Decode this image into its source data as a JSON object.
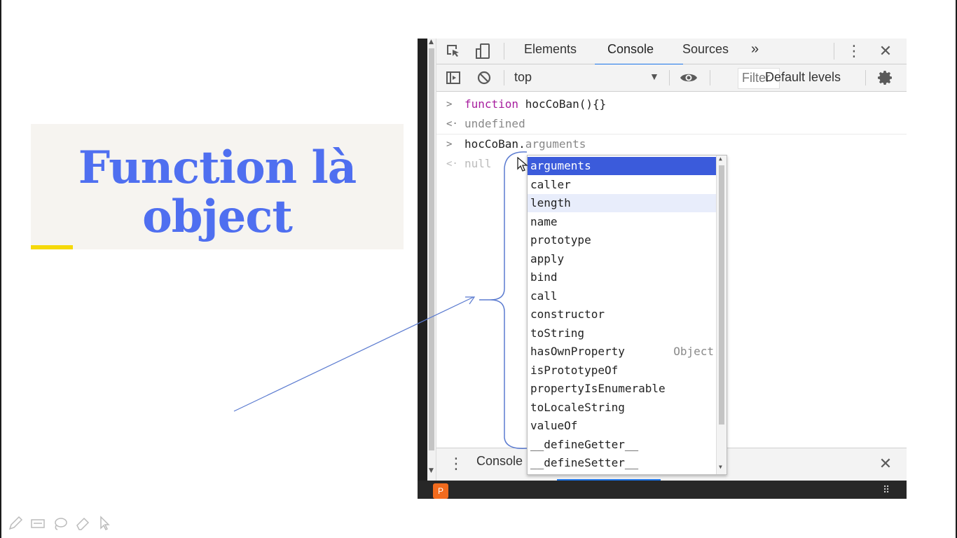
{
  "slide": {
    "title_line1": "Function là",
    "title_line2": "object"
  },
  "devtools": {
    "tabs": [
      "Elements",
      "Console",
      "Sources"
    ],
    "active_tab": "Console",
    "more_tabs_glyph": "»",
    "context_select": "top",
    "filter_placeholder": "Filter",
    "levels_select": "Default levels",
    "drawer_tab": "Console",
    "accent_color": "#1a73e8"
  },
  "console": {
    "lines": [
      {
        "prompt": ">",
        "keyword": "function",
        "text": " hocCoBan(){}"
      },
      {
        "prompt": "<·",
        "text": "undefined"
      },
      {
        "prompt": ">",
        "text": "hocCoBan.",
        "ghost": "arguments"
      },
      {
        "prompt": "<·",
        "text": "null"
      }
    ]
  },
  "autocomplete": {
    "items": [
      {
        "label": "arguments",
        "type": ""
      },
      {
        "label": "caller",
        "type": ""
      },
      {
        "label": "length",
        "type": ""
      },
      {
        "label": "name",
        "type": ""
      },
      {
        "label": "prototype",
        "type": ""
      },
      {
        "label": "apply",
        "type": ""
      },
      {
        "label": "bind",
        "type": ""
      },
      {
        "label": "call",
        "type": ""
      },
      {
        "label": "constructor",
        "type": ""
      },
      {
        "label": "toString",
        "type": ""
      },
      {
        "label": "hasOwnProperty",
        "type": "Object"
      },
      {
        "label": "isPrototypeOf",
        "type": ""
      },
      {
        "label": "propertyIsEnumerable",
        "type": ""
      },
      {
        "label": "toLocaleString",
        "type": ""
      },
      {
        "label": "valueOf",
        "type": ""
      },
      {
        "label": "__defineGetter__",
        "type": ""
      },
      {
        "label": "__defineSetter__",
        "type": ""
      }
    ],
    "selected": "arguments",
    "hovered": "length"
  },
  "taskbar": {
    "app_letter": "P"
  },
  "colors": {
    "title": "#4f6ff0",
    "accent_bar": "#f5d90a",
    "selection": "#3b5bdb",
    "annotation": "#5b7bd0"
  }
}
